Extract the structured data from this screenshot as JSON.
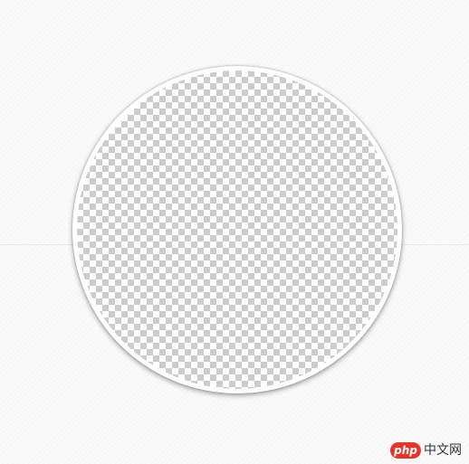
{
  "canvas": {
    "background_color": "#fafafa",
    "ring_color": "#ffffff",
    "checker_colors": [
      "#ffffff",
      "#cccccc"
    ]
  },
  "watermark": {
    "logo_text": "php",
    "logo_color": "#e8332b",
    "site_text": "中文网"
  }
}
